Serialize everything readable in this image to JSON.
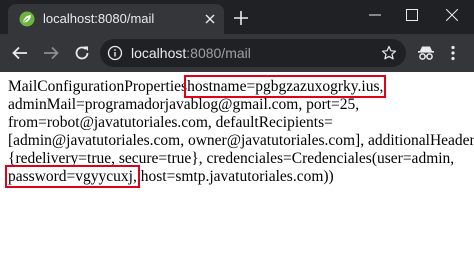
{
  "browser": {
    "tab_title": "localhost:8080/mail",
    "url_host": "localhost",
    "url_path": ":8080/mail"
  },
  "page": {
    "line1_prefix": "MailConfigurationProperties",
    "line1_highlight": "hostname=pgbgzazuxogrky.ius,",
    "line2": "adminMail=programadorjavablog@gmail.com, port=25,",
    "line3": "from=robot@javatutoriales.com, defaultRecipients=",
    "line4": "[admin@javatutoriales.com, owner@javatutoriales.com], additionalHeaders=",
    "line5": "{redelivery=true, secure=true}, credenciales=Credenciales(user=admin,",
    "line6_highlight": "password=vgyycuxj,",
    "line6_suffix": "host=smtp.javatutoriales.com))"
  },
  "colors": {
    "highlight_border": "#e0001a",
    "tabbar_bg": "#202124",
    "toolbar_bg": "#35363a"
  }
}
